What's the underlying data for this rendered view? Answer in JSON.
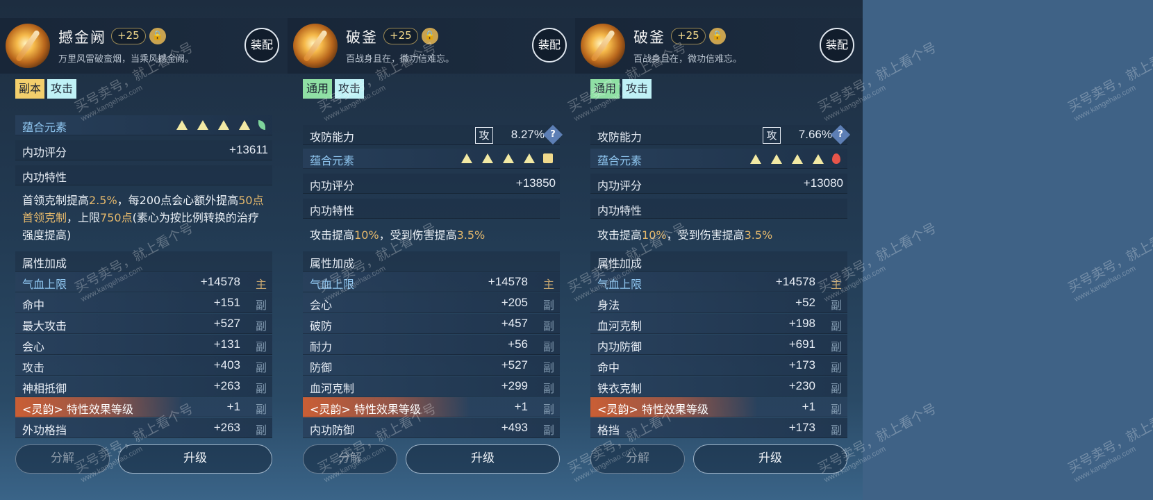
{
  "panels": [
    {
      "name": "撼金阙",
      "level": "+25",
      "lock": "🔒",
      "description": "万里风雷破蛮烟，当乘风撼金阙。",
      "equip_label": "装配",
      "tags": [
        "副本",
        "攻击"
      ],
      "element_label": "蕴合元素",
      "score_label": "内功评分",
      "score": "+13611",
      "trait_label": "内功特性",
      "trait_pre": "首领克制提高",
      "trait_v1": "2.5%",
      "trait_mid": "，每200点会心额外提高",
      "trait_v2": "50点首领克制",
      "trait_mid2": "，上限",
      "trait_v3": "750点",
      "trait_post": "(素心为按比例转换的治疗强度提高)",
      "attr_label": "属性加成",
      "attrs": [
        {
          "name": "气血上限",
          "value": "+14578",
          "src": "主"
        },
        {
          "name": "命中",
          "value": "+151",
          "src": "副"
        },
        {
          "name": "最大攻击",
          "value": "+527",
          "src": "副"
        },
        {
          "name": "会心",
          "value": "+131",
          "src": "副"
        },
        {
          "name": "攻击",
          "value": "+403",
          "src": "副"
        },
        {
          "name": "神相抵御",
          "value": "+263",
          "src": "副"
        },
        {
          "name": "<灵韵> 特性效果等级",
          "value": "+1",
          "src": "副"
        },
        {
          "name": "外功格挡",
          "value": "+263",
          "src": "副"
        }
      ],
      "decompose_label": "分解",
      "upgrade_label": "升级"
    },
    {
      "name": "破釜",
      "level": "+25",
      "lock": "🔒",
      "description": "百战身且在，微功信难忘。",
      "equip_label": "装配",
      "tags": [
        "通用",
        "攻击"
      ],
      "ability_label": "攻防能力",
      "ability_type": "攻",
      "ability_value": "8.27%",
      "help": "?",
      "element_label": "蕴合元素",
      "score_label": "内功评分",
      "score": "+13850",
      "trait_label": "内功特性",
      "trait_pre": "攻击提高",
      "trait_v1": "10%",
      "trait_mid": "，受到伤害提高",
      "trait_v2": "3.5%",
      "attr_label": "属性加成",
      "attrs": [
        {
          "name": "气血上限",
          "value": "+14578",
          "src": "主"
        },
        {
          "name": "会心",
          "value": "+205",
          "src": "副"
        },
        {
          "name": "破防",
          "value": "+457",
          "src": "副"
        },
        {
          "name": "耐力",
          "value": "+56",
          "src": "副"
        },
        {
          "name": "防御",
          "value": "+527",
          "src": "副"
        },
        {
          "name": "血河克制",
          "value": "+299",
          "src": "副"
        },
        {
          "name": "<灵韵> 特性效果等级",
          "value": "+1",
          "src": "副"
        },
        {
          "name": "内功防御",
          "value": "+493",
          "src": "副"
        }
      ],
      "decompose_label": "分解",
      "upgrade_label": "升级"
    },
    {
      "name": "破釜",
      "level": "+25",
      "lock": "🔒",
      "description": "百战身且在，微功信难忘。",
      "equip_label": "装配",
      "tags": [
        "通用",
        "攻击"
      ],
      "ability_label": "攻防能力",
      "ability_type": "攻",
      "ability_value": "7.66%",
      "help": "?",
      "element_label": "蕴合元素",
      "score_label": "内功评分",
      "score": "+13080",
      "trait_label": "内功特性",
      "trait_pre": "攻击提高",
      "trait_v1": "10%",
      "trait_mid": "，受到伤害提高",
      "trait_v2": "3.5%",
      "attr_label": "属性加成",
      "attrs": [
        {
          "name": "气血上限",
          "value": "+14578",
          "src": "主"
        },
        {
          "name": "身法",
          "value": "+52",
          "src": "副"
        },
        {
          "name": "血河克制",
          "value": "+198",
          "src": "副"
        },
        {
          "name": "内功防御",
          "value": "+691",
          "src": "副"
        },
        {
          "name": "命中",
          "value": "+173",
          "src": "副"
        },
        {
          "name": "铁衣克制",
          "value": "+230",
          "src": "副"
        },
        {
          "name": "<灵韵> 特性效果等级",
          "value": "+1",
          "src": "副"
        },
        {
          "name": "格挡",
          "value": "+173",
          "src": "副"
        }
      ],
      "decompose_label": "分解",
      "upgrade_label": "升级"
    }
  ],
  "watermark": {
    "text": "买号卖号，就上看个号",
    "url": "www.kangehao.com",
    "brand": "看个号"
  },
  "colors": {
    "highlight": "#e6b96c",
    "lingyun": "#d25f32",
    "tag_yellow": "#f3cf6c",
    "tag_green": "#8fe0a4",
    "tag_cyan": "#bff1f6"
  }
}
